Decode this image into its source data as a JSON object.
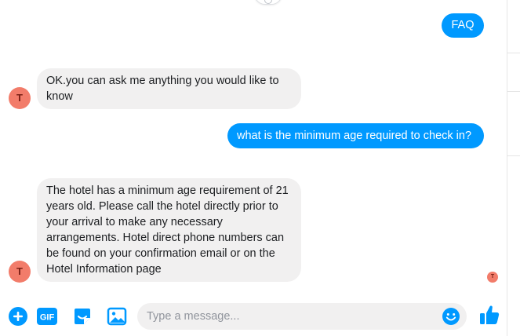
{
  "conversation": {
    "messages": [
      {
        "from": "user",
        "text": "FAQ"
      },
      {
        "from": "bot",
        "text": "OK.you can ask me anything you would like to know"
      },
      {
        "from": "user",
        "text": "what is the minimum age required to check in?"
      },
      {
        "from": "bot",
        "text": "The hotel has a minimum age requirement of 21 years old. Please call the hotel directly prior to your arrival to make any necessary arrangements. Hotel direct phone numbers can be found on your confirmation email or on the Hotel Information page"
      }
    ],
    "bot_avatar_initial": "T",
    "seen_avatar_initial": "T"
  },
  "composer": {
    "placeholder": "Type a message...",
    "value": "",
    "icons": {
      "add": "plus-circle-icon",
      "gif": "gif-icon",
      "sticker": "sticker-icon",
      "photo": "image-icon",
      "emoji": "smiley-icon",
      "like": "thumbs-up-icon"
    }
  },
  "colors": {
    "accent": "#0099ff",
    "incoming_bubble": "#f1f0f0",
    "avatar": "#f27c6a"
  }
}
